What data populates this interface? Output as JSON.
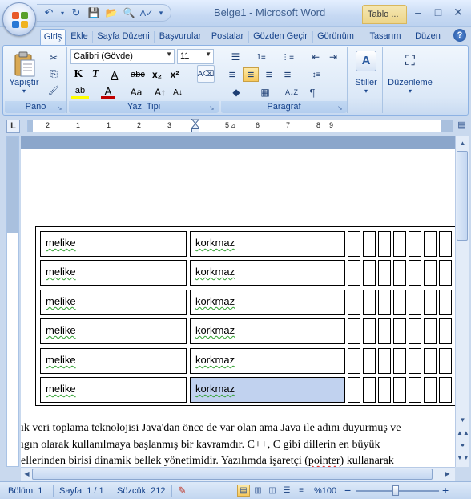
{
  "window": {
    "title": "Belge1 - Microsoft Word",
    "context_tab": "Tablo ...",
    "minimize": "–",
    "maximize": "□",
    "close": "✕"
  },
  "quick_access": {
    "undo": "↶",
    "redo": "↻",
    "save": "💾",
    "open": "📂",
    "print_preview": "🔍",
    "spelling": "A✓",
    "more": "▾"
  },
  "tabs": [
    "Giriş",
    "Ekle",
    "Sayfa Düzeni",
    "Başvurular",
    "Postalar",
    "Gözden Geçir",
    "Görünüm",
    "Tasarım",
    "Düzen"
  ],
  "active_tab": "Giriş",
  "help": "?",
  "ribbon": {
    "clipboard": {
      "label": "Pano",
      "paste": "Yapıştır",
      "cut": "✂",
      "copy": "⎘",
      "format_painter": "🖌"
    },
    "font": {
      "label": "Yazı Tipi",
      "font_name": "Calibri (Gövde)",
      "font_size": "11",
      "bold": "K",
      "italic": "T",
      "underline": "A",
      "strikethrough": "abc",
      "subscript": "x₂",
      "superscript": "x²",
      "clear_format": "A⌫",
      "highlight": "ab",
      "font_color": "A",
      "change_case": "Aa",
      "grow": "A↑",
      "shrink": "A↓"
    },
    "paragraph": {
      "label": "Paragraf",
      "bullets": "☰",
      "numbering": "1≡",
      "multilevel": "⋮≡",
      "decrease_indent": "⇤",
      "increase_indent": "⇥",
      "align_left": "≡",
      "align_center": "≡",
      "align_right": "≡",
      "justify": "≡",
      "line_spacing": "↕≡",
      "shading": "◆",
      "borders": "▦",
      "sort": "A↓Z",
      "show_marks": "¶"
    },
    "styles": {
      "label": "Stiller"
    },
    "editing": {
      "label": "Düzenleme"
    }
  },
  "ruler": {
    "corner": "L",
    "numbers": [
      "1",
      "2",
      "1",
      "2",
      "3",
      "4",
      "5",
      "6",
      "7",
      "8",
      "9",
      "10"
    ]
  },
  "table": {
    "rows": [
      {
        "name": "melike",
        "surname": "korkmaz"
      },
      {
        "name": "melike",
        "surname": "korkmaz"
      },
      {
        "name": "melike",
        "surname": "korkmaz"
      },
      {
        "name": "melike",
        "surname": "korkmaz"
      },
      {
        "name": "melike",
        "surname": "korkmaz"
      },
      {
        "name": "melike",
        "surname": "korkmaz"
      }
    ],
    "selected_cell": "row 6 / column 2"
  },
  "body_text": {
    "line1": "ık veri toplama teknolojisi  Java'dan önce de var olan ama Java ile adını duyurmuş ve",
    "line2": "ıgın olarak kullanılmaya  başlanmış  bir  kavramdır.  C++, C gibi dillerin en büyük",
    "line3_a": "ellerinden birisi  dinamik bellek  yönetimidir.  Yazılımda işaretçi  (",
    "line3_pointer": "pointer",
    "line3_b": ") kullanarak"
  },
  "statusbar": {
    "section": "Bölüm: 1",
    "page": "Sayfa: 1 / 1",
    "words": "Sözcük: 212",
    "zoom": "%100",
    "zoom_out": "−",
    "zoom_in": "+"
  }
}
